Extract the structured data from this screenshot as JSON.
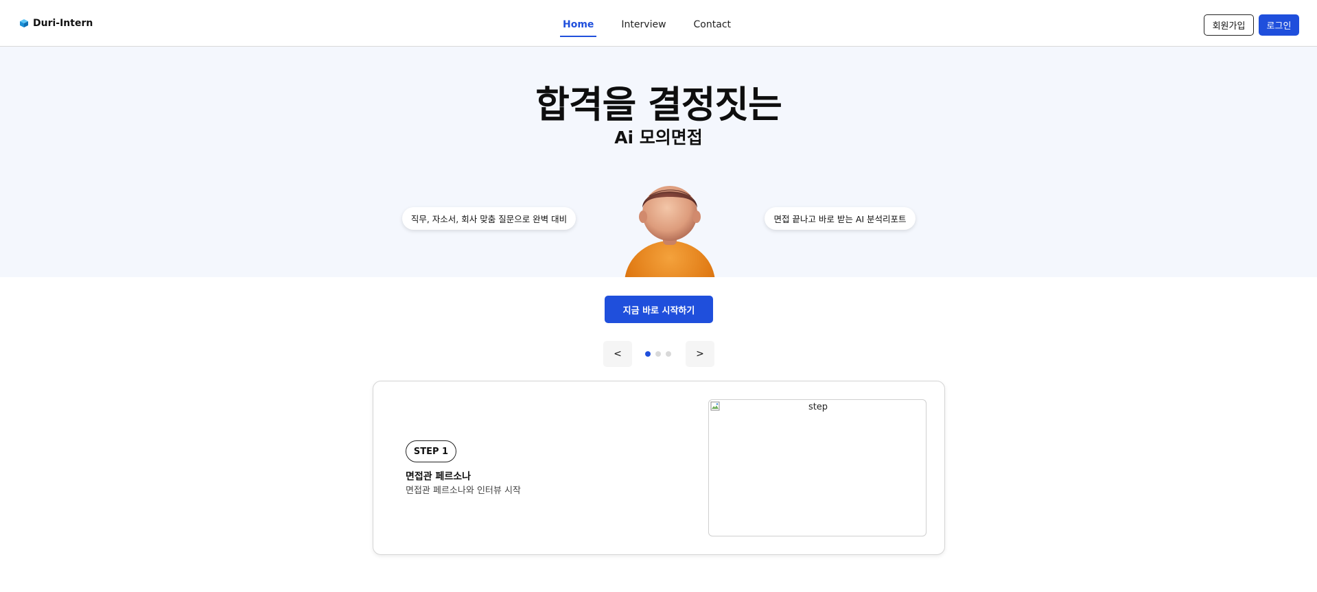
{
  "header": {
    "brand": "Duri-Intern",
    "nav": [
      {
        "label": "Home",
        "active": true
      },
      {
        "label": "Interview",
        "active": false
      },
      {
        "label": "Contact",
        "active": false
      }
    ],
    "signup_label": "회원가입",
    "login_label": "로그인"
  },
  "hero": {
    "title": "합격을 결정짓는",
    "subtitle": "Ai 모의면접",
    "bubble_left": "직무, 자소서, 회사 맞춤 질문으로 완벽 대비",
    "bubble_right": "면접 끝나고 바로 받는 AI 분석리포트"
  },
  "cta_label": "지금 바로 시작하기",
  "carousel": {
    "prev_label": "<",
    "next_label": ">",
    "active_index": 0,
    "total": 3
  },
  "card": {
    "step_label": "STEP 1",
    "title": "면접관 페르소나",
    "description": "면접관 페르소나와 인터뷰 시작",
    "image_alt": "step"
  },
  "colors": {
    "accent": "#1f4fdc",
    "hero_bg": "#f4f7fd",
    "logo": "#1a8fd6"
  },
  "icons": {
    "logo": "cube-icon",
    "avatar": "person-3d-avatar",
    "image": "broken-image-icon"
  }
}
